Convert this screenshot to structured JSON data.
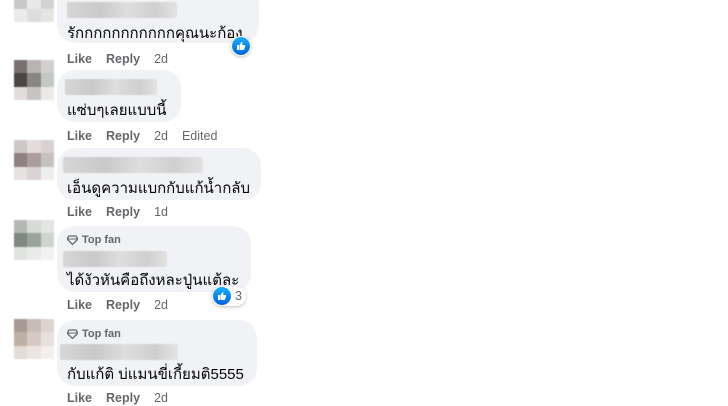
{
  "colors": {
    "bubble": "#f0f2f5",
    "text": "#050505",
    "meta": "#65676b",
    "like_blue": "#0866ff"
  },
  "comments": [
    {
      "text": "รักกกกกกกกกกกคุณนะก้อง",
      "top_fan": false,
      "actions": {
        "like": "Like",
        "reply": "Reply",
        "time": "2d"
      },
      "reaction_icon": "like-icon"
    },
    {
      "text": "แซ่บๆเลยแบบนี้",
      "top_fan": false,
      "actions": {
        "like": "Like",
        "reply": "Reply",
        "time": "2d",
        "edited": "Edited"
      }
    },
    {
      "text": "เอ็นดูความแบกกับแก้น้ำกลับ",
      "top_fan": false,
      "actions": {
        "like": "Like",
        "reply": "Reply",
        "time": "1d"
      }
    },
    {
      "text": "ได้งัวหันคือถึงหละปู่นแต้ละ",
      "top_fan": true,
      "badge": "Top fan",
      "actions": {
        "like": "Like",
        "reply": "Reply",
        "time": "2d"
      },
      "reaction_icon": "like-icon",
      "reaction_count": "3"
    },
    {
      "text": "กับแก้ติ บ่แมนขี่เกี้ยมติ5555",
      "top_fan": true,
      "badge": "Top fan",
      "actions": {
        "like": "Like",
        "reply": "Reply",
        "time": "2d"
      }
    }
  ]
}
